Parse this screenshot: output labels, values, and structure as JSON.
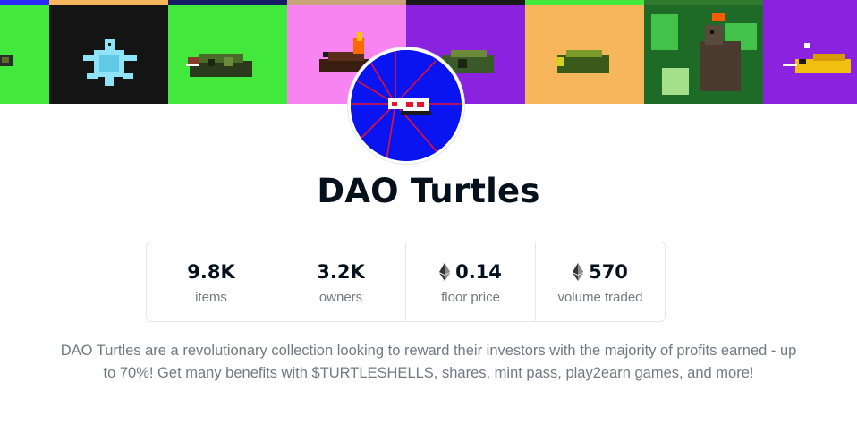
{
  "collection": {
    "name": "DAO Turtles",
    "description": "DAO Turtles are a revolutionary collection looking to reward their investors with the majority of profits earned - up to 70%! Get many benefits with $TURTLESHELLS, shares, mint pass, play2earn games, and more!"
  },
  "stats": [
    {
      "value": "9.8K",
      "label": "items",
      "icon": null
    },
    {
      "value": "3.2K",
      "label": "owners",
      "icon": null
    },
    {
      "value": "0.14",
      "label": "floor price",
      "icon": "ethereum-icon"
    },
    {
      "value": "570",
      "label": "volume traded",
      "icon": "ethereum-icon"
    }
  ],
  "colors": {
    "title": "#04111d",
    "muted_text": "#707a83",
    "border": "#e5e8eb",
    "avatar_background": "#0a14f0"
  }
}
